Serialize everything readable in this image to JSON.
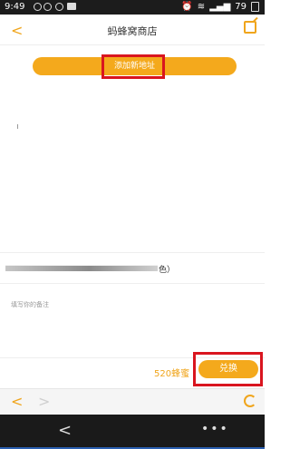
{
  "status_bar": {
    "time": "9:49",
    "battery": "79"
  },
  "nav": {
    "title": "蚂蜂窝商店",
    "back_icon": "chevron-left-icon",
    "share_icon": "share-icon"
  },
  "add_address_label": "添加新地址",
  "product": {
    "tail_text": "色）"
  },
  "remark_placeholder": "填写你的备注",
  "footer": {
    "price": "520蜂蜜",
    "exchange_label": "兑换"
  },
  "browser": {
    "back_icon": "browser-back-icon",
    "forward_icon": "browser-forward-icon",
    "refresh_icon": "refresh-icon"
  },
  "colors": {
    "accent": "#f4a91c",
    "highlight": "#d9151f"
  }
}
